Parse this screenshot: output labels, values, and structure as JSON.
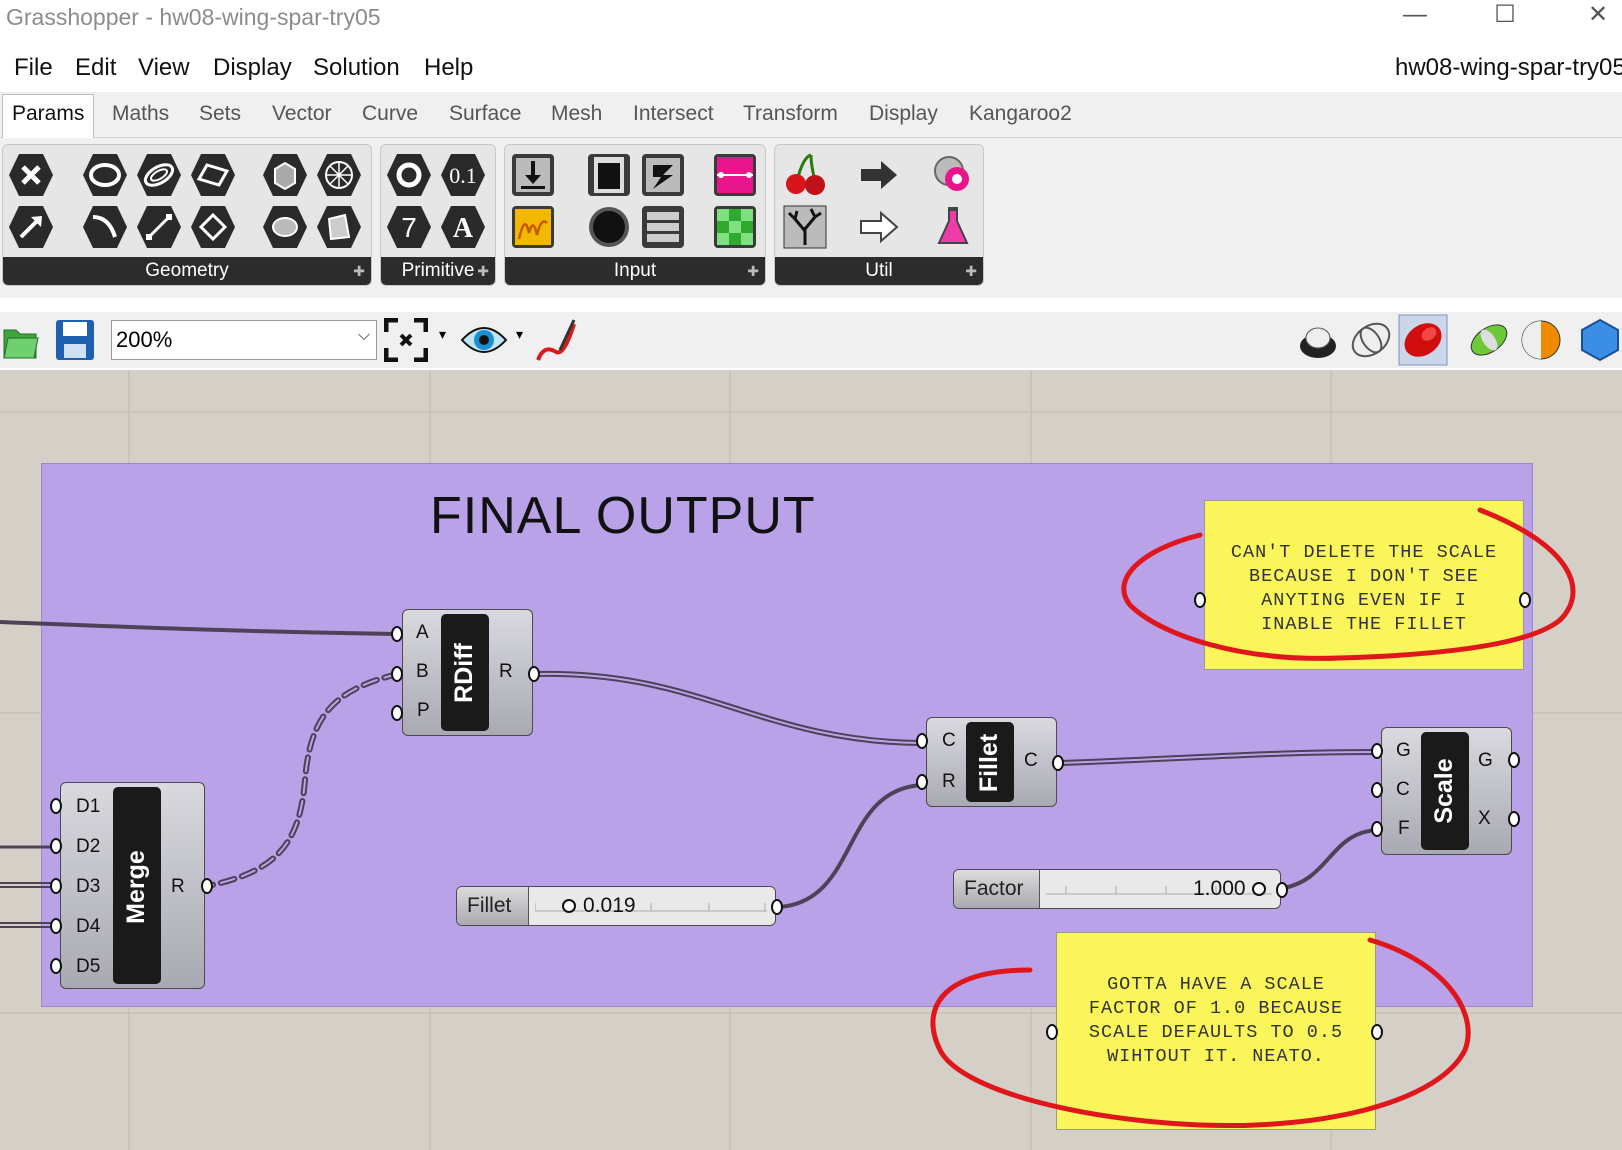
{
  "window": {
    "title": "Grasshopper - hw08-wing-spar-try05",
    "minimize": "—",
    "maximize": "☐",
    "close": "✕"
  },
  "menu": {
    "items": [
      "File",
      "Edit",
      "View",
      "Display",
      "Solution",
      "Help"
    ],
    "document_name": "hw08-wing-spar-try05"
  },
  "tabs": [
    "Params",
    "Maths",
    "Sets",
    "Vector",
    "Curve",
    "Surface",
    "Mesh",
    "Intersect",
    "Transform",
    "Display",
    "Kangaroo2"
  ],
  "active_tab": "Params",
  "ribbon": {
    "panels": [
      {
        "label": "Geometry",
        "icons": [
          "point-icon",
          "circle-icon",
          "circular-arc-icon",
          "rectangle-icon",
          "box-icon",
          "mesh-icon",
          "vector-icon",
          "arc-icon",
          "line-icon",
          "plane-icon",
          "brep-icon",
          "surface-icon"
        ]
      },
      {
        "label": "Primitive",
        "icons": [
          "boolean-icon",
          "number-icon",
          "integer-icon",
          "text-icon"
        ]
      },
      {
        "label": "Input",
        "icons": [
          "data-input-icon",
          "toggle-icon",
          "graph-mapper-icon",
          "gradient-icon",
          "panel-icon",
          "button-icon",
          "value-list-icon",
          "colour-swatch-icon"
        ]
      },
      {
        "label": "Util",
        "icons": [
          "cherry-icon",
          "relay-icon",
          "cluster-icon",
          "tree-icon",
          "arrow-out-icon",
          "flask-icon"
        ]
      }
    ],
    "more_glyph": "✚"
  },
  "canvas_toolbar": {
    "zoom": "200%",
    "zoom_arrow": "⌵",
    "drop_arrow": "▾"
  },
  "canvas": {
    "group_title": "FINAL OUTPUT",
    "components": {
      "rdiff": {
        "name": "RDiff",
        "inputs": [
          "A",
          "B",
          "P"
        ],
        "outputs": [
          "R"
        ]
      },
      "merge": {
        "name": "Merge",
        "inputs": [
          "D1",
          "D2",
          "D3",
          "D4",
          "D5"
        ],
        "outputs": [
          "R"
        ]
      },
      "fillet": {
        "name": "Fillet",
        "inputs": [
          "C",
          "R"
        ],
        "outputs": [
          "C"
        ]
      },
      "scale": {
        "name": "Scale",
        "inputs": [
          "G",
          "C",
          "F"
        ],
        "outputs": [
          "G",
          "X"
        ]
      }
    },
    "sliders": {
      "fillet": {
        "name": "Fillet",
        "value": "0.019",
        "fraction": 0.02
      },
      "factor": {
        "name": "Factor",
        "value": "1.000",
        "fraction": 1.0
      }
    },
    "notes": {
      "scale_note": [
        "CAN'T DELETE THE SCALE",
        "BECAUSE I DON'T SEE",
        "ANYTING EVEN IF I",
        "INABLE THE FILLET"
      ],
      "factor_note": [
        "GOTTA HAVE A SCALE",
        "FACTOR OF 1.0 BECAUSE",
        "SCALE DEFAULTS TO 0.5",
        "WIHTOUT IT. NEATO."
      ]
    },
    "colors": {
      "group_fill": "#b9a2e8",
      "note_fill": "#faf55a",
      "annotation_red": "#e0161d",
      "canvas_bg": "#d4d0c8"
    }
  }
}
